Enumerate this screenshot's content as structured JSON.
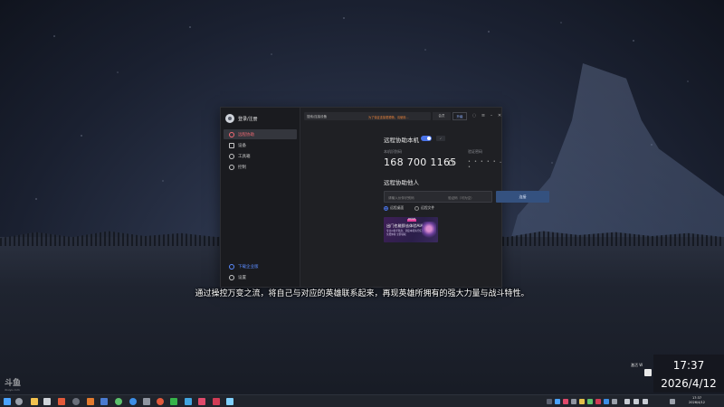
{
  "app": {
    "profile_label": "登录/注册",
    "nav": [
      {
        "label": "远程协助",
        "icon": "remote-icon",
        "active": true
      },
      {
        "label": "设备",
        "icon": "monitor-icon",
        "active": false
      },
      {
        "label": "工具箱",
        "icon": "toolbox-icon",
        "active": false
      },
      {
        "label": "控制",
        "icon": "control-icon",
        "active": false
      }
    ],
    "sidebar_bottom": [
      {
        "label": "下载企业版",
        "icon": "download-icon"
      },
      {
        "label": "设置",
        "icon": "gear-icon"
      }
    ],
    "topbar": {
      "search_text": "搜索/连接设备",
      "notice": "为了保证连接更顺畅，请使用...",
      "button_a": "会员",
      "button_b": "升级"
    },
    "allow": {
      "title": "远程协助本机",
      "tag": "✓",
      "code_label": "本机识别码",
      "code": "168 700 1165",
      "password_label": "验证密码",
      "password_mask": "• • • • • •"
    },
    "assist": {
      "title": "远程协助他人",
      "code_placeholder": "请输入伙伴识别码",
      "password_placeholder": "验证码（可为空）",
      "connect_label": "连接",
      "option_desktop": "远程桌面",
      "option_file": "远程文件"
    },
    "banner": {
      "tag": "限时免费",
      "title": "出门也能即去体验AIAgent",
      "line1": "专业AI助手随身，调度本机执行任务",
      "line2": "免费体验   立即领取"
    }
  },
  "subtitle": "通过操控万变之流，将自己与对应的英雄联系起来，再现英雄所拥有的强大力量与战斗特性。",
  "watermark": {
    "top": "斗鱼",
    "bottom": "douyu.com"
  },
  "overlay": {
    "time": "17:37",
    "date": "2026/4/12",
    "side_text": "激活 W"
  },
  "taskbar": {
    "time": "17:37",
    "date": "2026/4/12"
  },
  "colors": {
    "accent_blue": "#4a73e8",
    "active_red": "#f46a73",
    "notice_orange": "#e8823b"
  }
}
